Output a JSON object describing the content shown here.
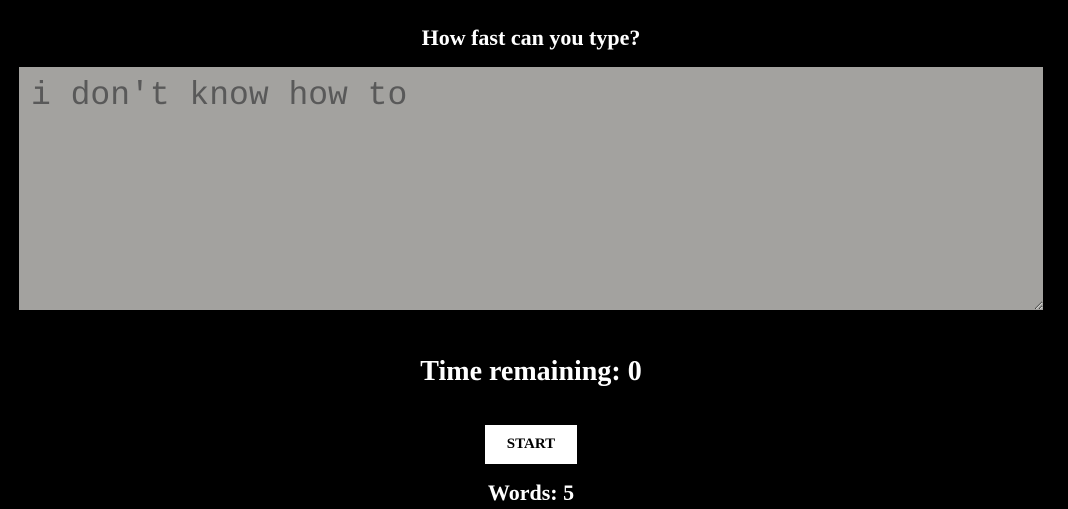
{
  "heading": "How fast can you type?",
  "typing_area": {
    "value": "i don't know how to"
  },
  "timer": {
    "text": "Time remaining: 0"
  },
  "start_button": {
    "label": "START"
  },
  "word_count": {
    "text": "Words: 5"
  },
  "colors": {
    "background": "#000000",
    "text": "#ffffff",
    "textarea_background": "#a3a29f",
    "textarea_text": "#595959",
    "button_background": "#ffffff",
    "button_text": "#000000"
  }
}
